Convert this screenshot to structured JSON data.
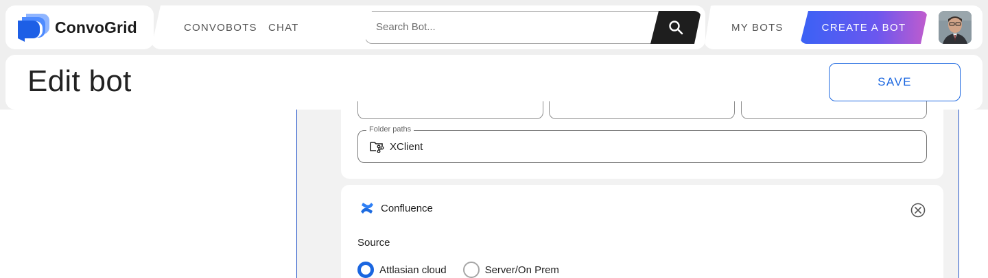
{
  "brand": {
    "name": "ConvoGrid",
    "logo_icon": "chat-bubbles-logo"
  },
  "nav": {
    "convobots": "CONVOBOTS",
    "chat": "CHAT"
  },
  "search": {
    "placeholder": "Search Bot...",
    "value": "",
    "icon": "search-icon"
  },
  "account": {
    "my_bots": "MY BOTS",
    "create_bot": "CREATE A BOT"
  },
  "page": {
    "title": "Edit bot",
    "save_label": "SAVE"
  },
  "folder": {
    "label": "Folder paths",
    "value": "XClient",
    "icon": "folder-branch-icon"
  },
  "confluence": {
    "name": "Confluence",
    "icon": "confluence-icon",
    "source_label": "Source",
    "options": [
      {
        "label": "Attlasian cloud",
        "selected": true
      },
      {
        "label": "Server/On Prem",
        "selected": false
      }
    ]
  },
  "colors": {
    "accent": "#1a66e0",
    "gradient_start": "#3a62f5",
    "gradient_end": "#c15ccd",
    "dark": "#1e1e1e"
  }
}
